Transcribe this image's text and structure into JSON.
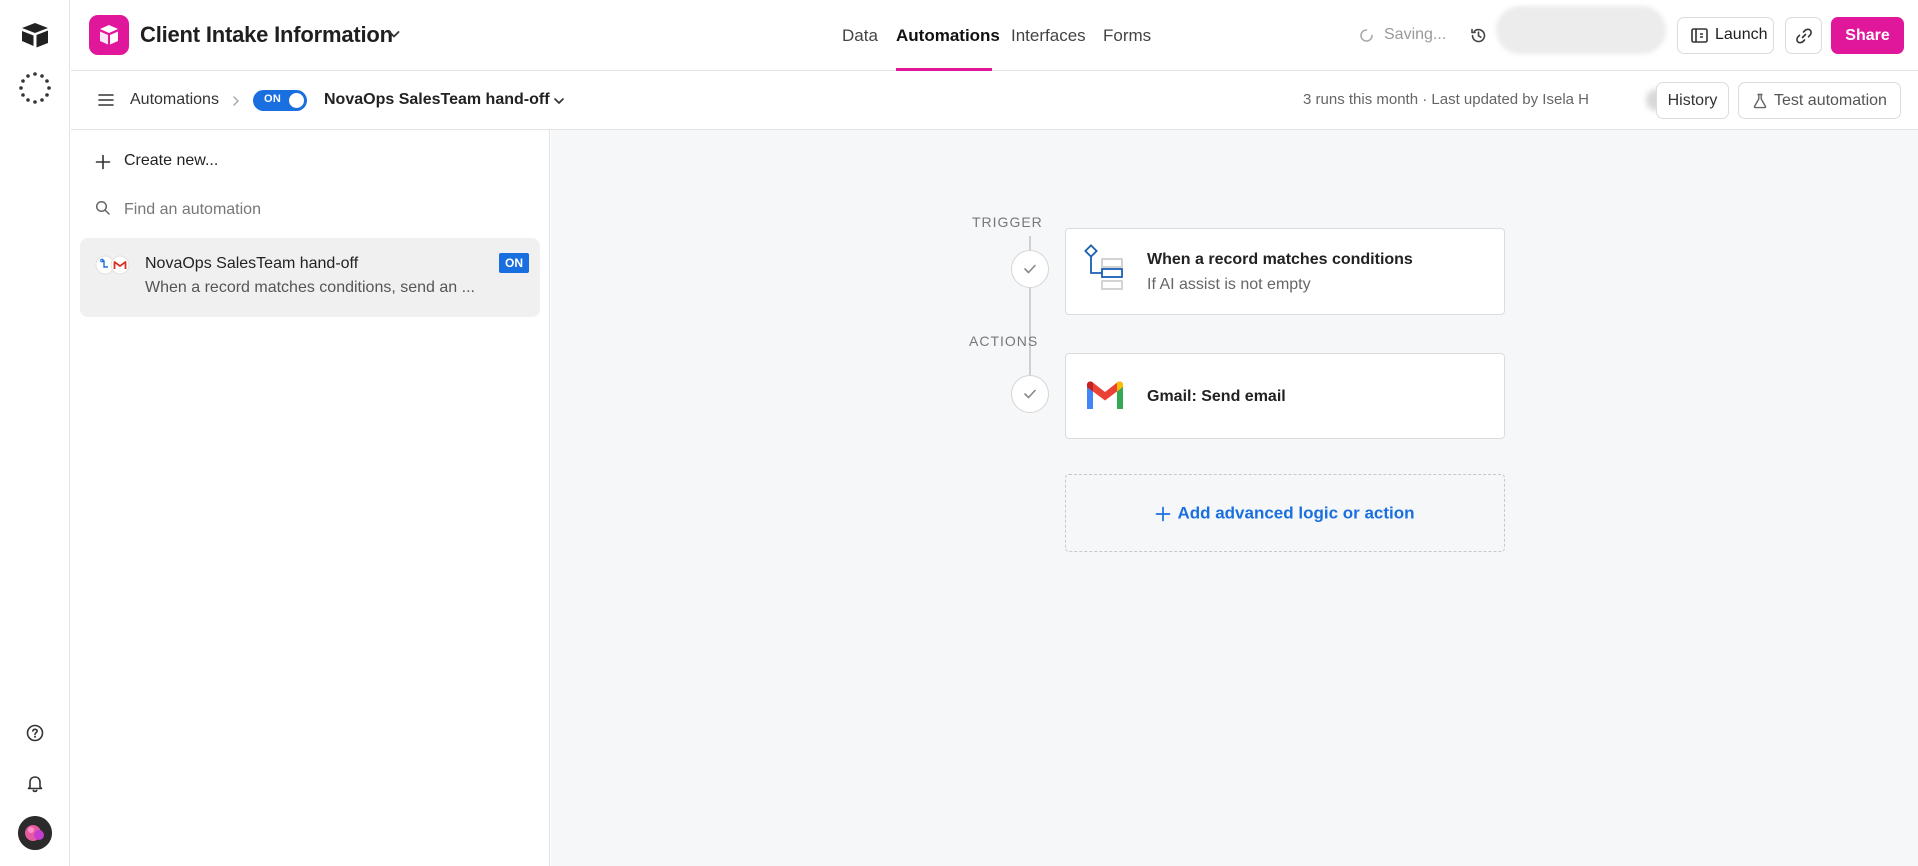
{
  "app": {
    "base_title": "Client Intake Information",
    "tabs": [
      {
        "label": "Data"
      },
      {
        "label": "Automations"
      },
      {
        "label": "Interfaces"
      },
      {
        "label": "Forms"
      }
    ],
    "active_tab": "Automations",
    "saving_status": "Saving...",
    "launch_label": "Launch",
    "share_label": "Share",
    "accent_color": "#e0169b"
  },
  "subbar": {
    "breadcrumb": "Automations",
    "toggle_label": "ON",
    "automation_name": "NovaOps SalesTeam hand-off",
    "meta": "3 runs this month · Last updated by Isela H",
    "history_label": "History",
    "test_label": "Test automation"
  },
  "panel": {
    "create_label": "Create new...",
    "search_placeholder": "Find an automation",
    "items": [
      {
        "title": "NovaOps SalesTeam hand-off",
        "description": "When a record matches conditions, send an ...",
        "status": "ON"
      }
    ]
  },
  "canvas": {
    "trigger_label": "TRIGGER",
    "actions_label": "ACTIONS",
    "trigger": {
      "title": "When a record matches conditions",
      "subtitle": "If AI assist is not empty"
    },
    "action": {
      "title": "Gmail: Send email"
    },
    "add_label": "Add advanced logic or action"
  },
  "icons": {
    "logo": "airtable-logo-icon",
    "workspace": "workspace-icon",
    "help": "help-icon",
    "notifications": "bell-icon",
    "history": "history-icon",
    "link": "link-icon",
    "test": "flask-icon",
    "trigger": "conditions-icon",
    "action": "gmail-icon"
  },
  "colors": {
    "toggle_on": "#1a6fe0",
    "link_blue": "#1a6fe0",
    "canvas_bg": "#f6f7f9"
  }
}
